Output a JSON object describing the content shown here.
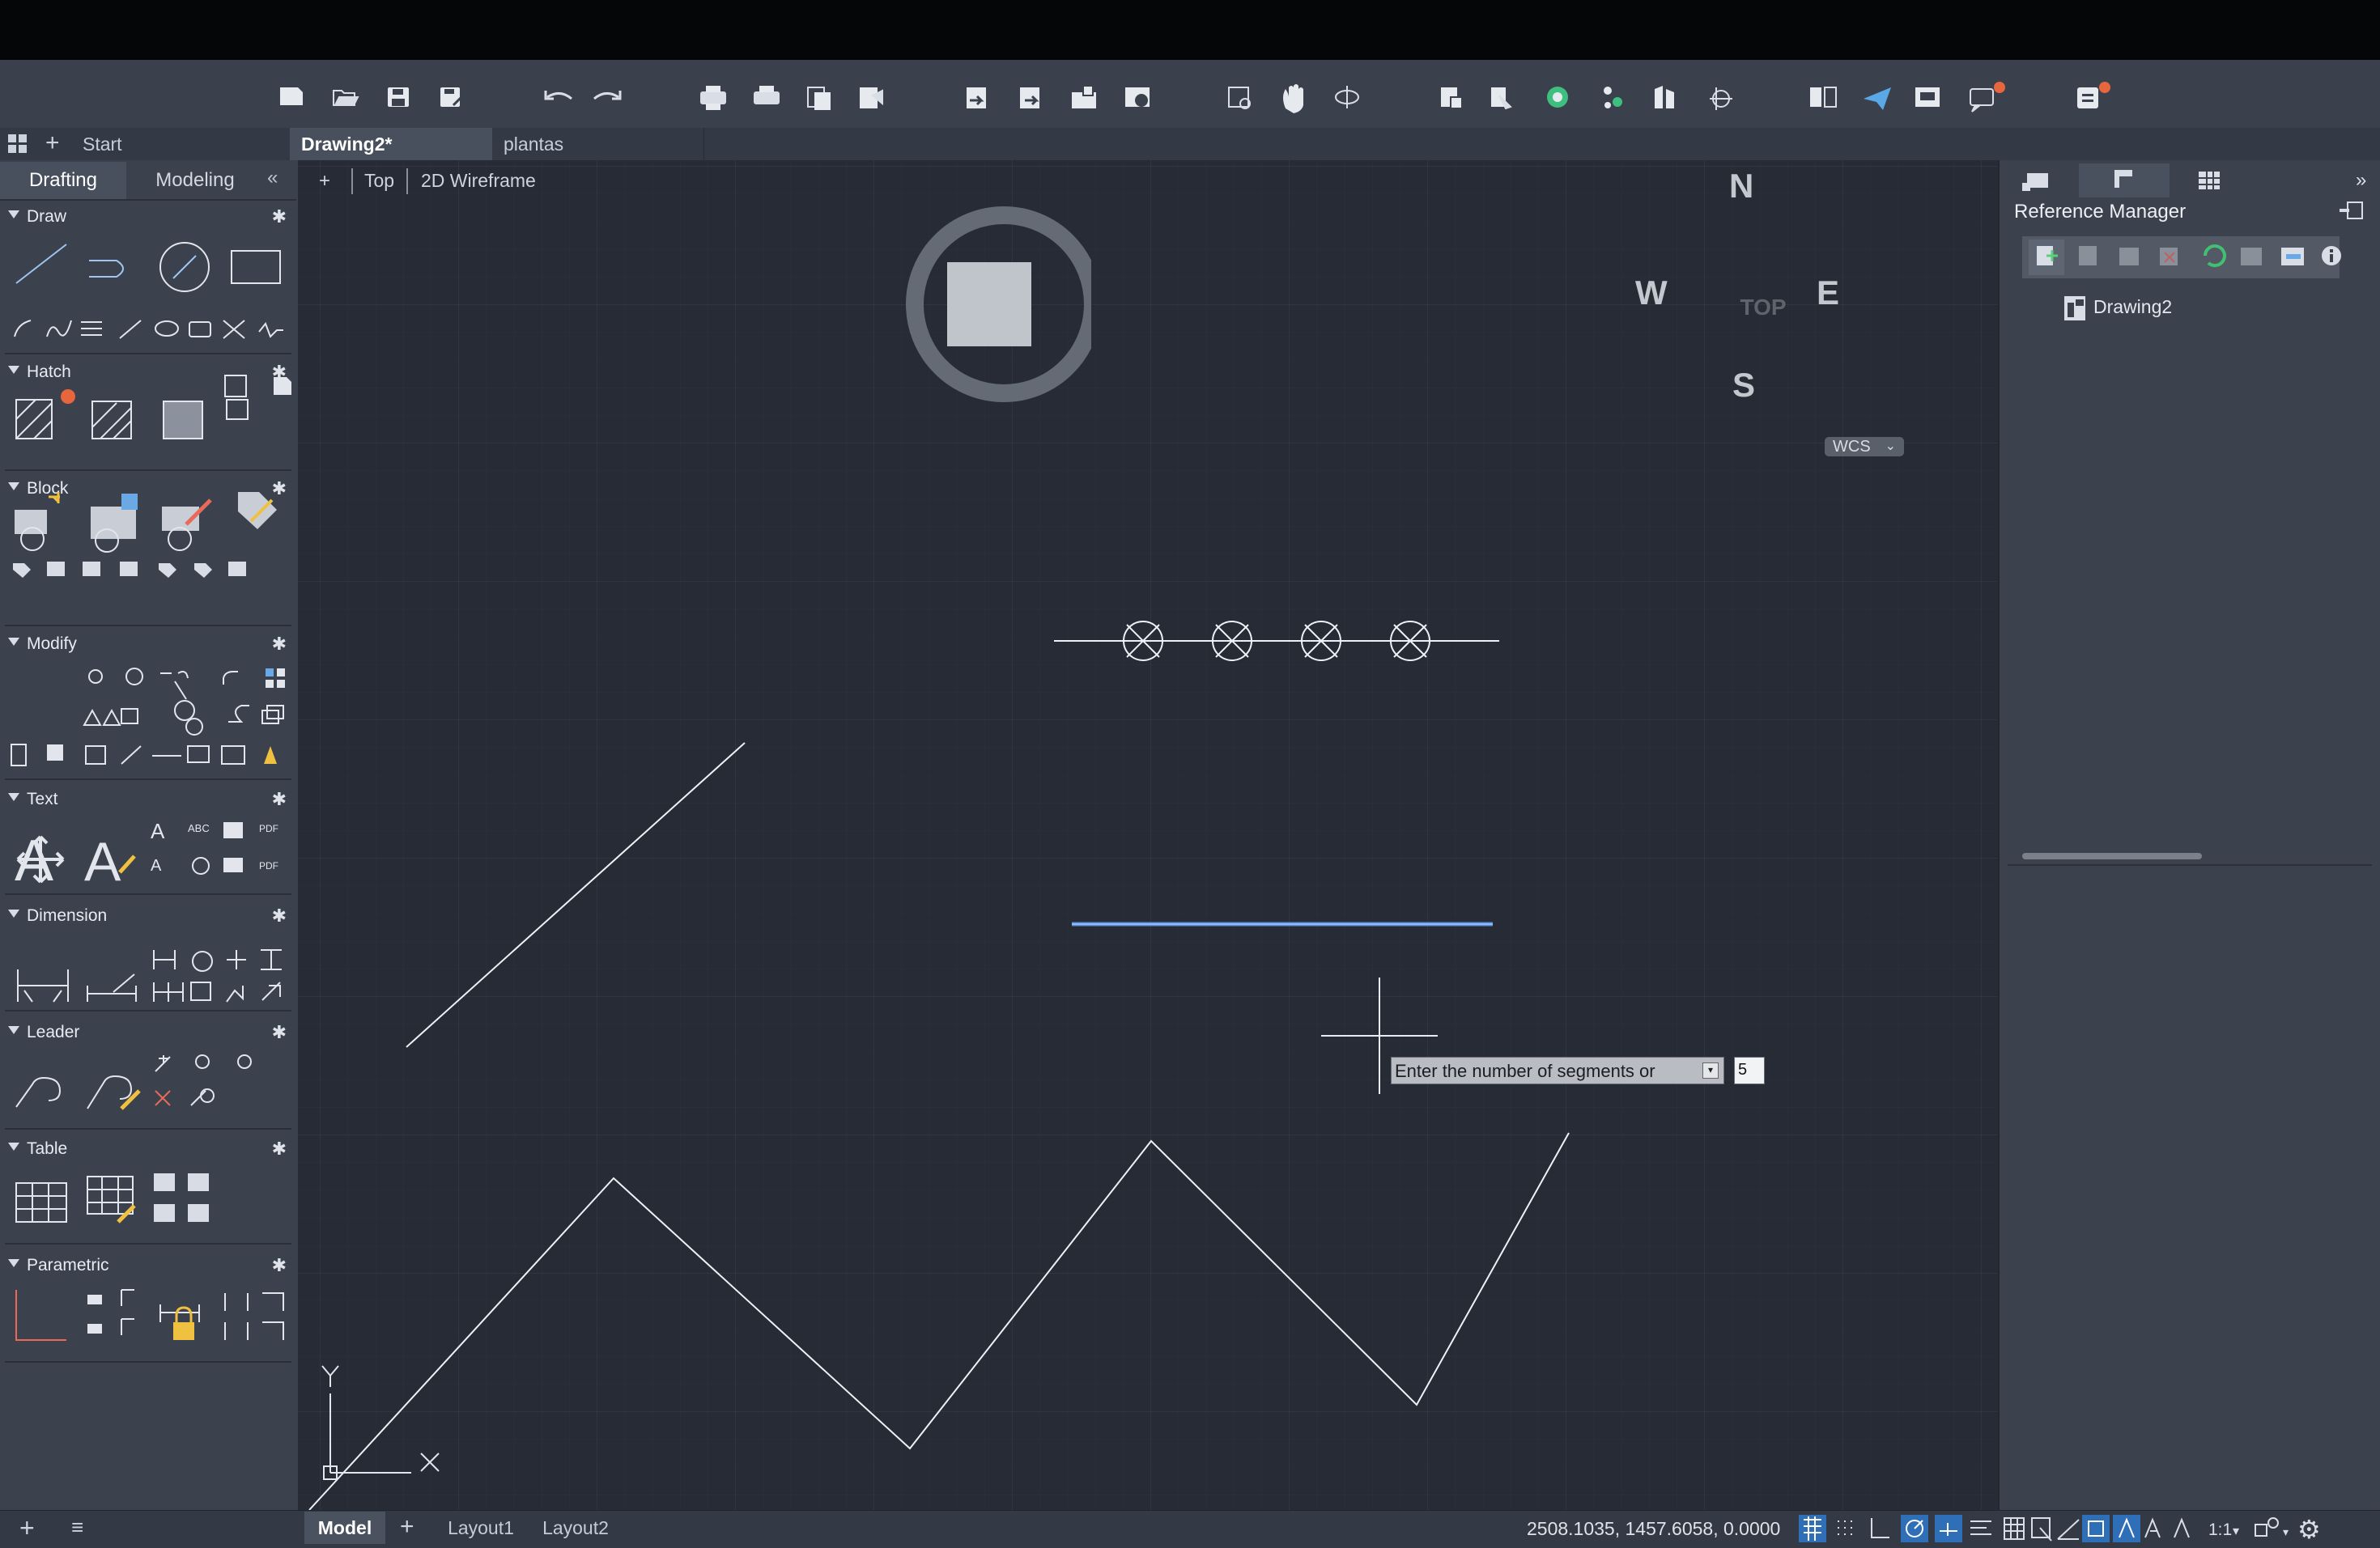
{
  "toolbar": {
    "icons": [
      "new-icon",
      "open-icon",
      "save-icon",
      "save-as-icon",
      "undo-icon",
      "redo-icon",
      "plot-icon",
      "batch-plot-icon",
      "page-setup-icon",
      "publish-icon",
      "import-icon",
      "export-icon",
      "attach-icon",
      "share-icon",
      "zoom-window-icon",
      "pan-icon",
      "orbit-icon",
      "layer-properties-icon",
      "layer-match-icon",
      "render-icon",
      "point-cloud-icon",
      "measure-icon",
      "coordinate-icon",
      "compare-icon",
      "send-icon",
      "sheet-set-icon",
      "notifications-icon",
      "app-menu-icon"
    ]
  },
  "tabs": {
    "start": "Start",
    "drawing2": "Drawing2*",
    "plantas": "plantas"
  },
  "left_panel": {
    "tabs": [
      "Drafting",
      "Modeling"
    ],
    "sections": [
      {
        "name": "Draw"
      },
      {
        "name": "Hatch"
      },
      {
        "name": "Block"
      },
      {
        "name": "Modify"
      },
      {
        "name": "Text"
      },
      {
        "name": "Dimension"
      },
      {
        "name": "Leader"
      },
      {
        "name": "Table"
      },
      {
        "name": "Parametric"
      }
    ]
  },
  "viewport": {
    "plus": "+",
    "view": "Top",
    "style": "2D Wireframe"
  },
  "viewcube": {
    "n": "N",
    "s": "S",
    "e": "E",
    "w": "W",
    "face": "TOP",
    "wcs": "WCS"
  },
  "ucs": {
    "x": "X",
    "y": "Y"
  },
  "command": {
    "prompt": "Enter the number of segments or",
    "value": "5"
  },
  "right_panel": {
    "title": "Reference Manager",
    "tree_item": "Drawing2"
  },
  "status": {
    "layouts": [
      "Model",
      "Layout1",
      "Layout2"
    ],
    "coordinates": "2508.1035, 1457.6058, 0.0000",
    "scale": "1:1"
  },
  "colors": {
    "canvas": "#262b35",
    "panel": "#3b414d",
    "selected_line": "#5b8fe0",
    "accent_badge": "#e8663c"
  }
}
